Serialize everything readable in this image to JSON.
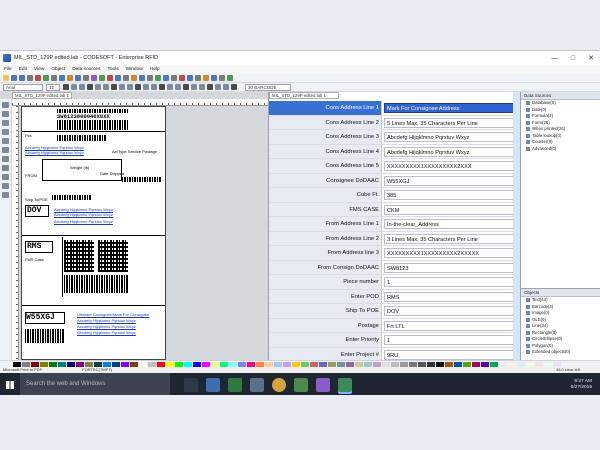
{
  "window": {
    "title": "MIL_STD_129P edited.lab - CODESOFT - Enterprise RFID",
    "controls": [
      "—",
      "□",
      "✕"
    ]
  },
  "menu": [
    "File",
    "Edit",
    "View",
    "Object",
    "Data sources",
    "Tools",
    "Window",
    "Help"
  ],
  "toolbar": {
    "font_combo": "Arial",
    "font_size": "12",
    "object_combo": "30 BARCODE"
  },
  "doc_tab": "MIL_STD_129P edited.lab 1",
  "prop_tab": "MIL_STD_129P edited.lab 1",
  "properties": [
    {
      "name": "Cons Address Line 1",
      "value": "Mark For Consignee Address",
      "selected": true
    },
    {
      "name": "Cons Address Line 2",
      "value": "5 Lines Max, 35 Characters Per Line"
    },
    {
      "name": "Cons Address Line 3",
      "value": "Abcdefg Hijqklmno Pqrstuv Wxyz"
    },
    {
      "name": "Cons Address Line 4",
      "value": "Abcdefg Hijqklmno Pqrstuv Wxyz"
    },
    {
      "name": "Cons Address Line 5",
      "value": "XXXXXXXXX1XXXXXXXXX2XXX"
    },
    {
      "name": "Consignee DoDAAC",
      "value": "W55XGJ"
    },
    {
      "name": "Cube Ft.",
      "value": "385"
    },
    {
      "name": "FMS CASE",
      "value": "CKM"
    },
    {
      "name": "From Address Line 1",
      "value": "In-the-clear_Address"
    },
    {
      "name": "From Address Line 2",
      "value": "3 Lines Max, 35 Characters Per Line"
    },
    {
      "name": "From Address line 3",
      "value": "XXXXXXXXX1XXXXXXXXX2XXXXX"
    },
    {
      "name": "From Consign DoDAAC",
      "value": "SW8123"
    },
    {
      "name": "Piece number",
      "value": "1"
    },
    {
      "name": "Enter POD",
      "value": "RMS"
    },
    {
      "name": "Ship To POE",
      "value": "DOV"
    },
    {
      "name": "Postage",
      "value": "Frt LTL"
    },
    {
      "name": "Enter Priority",
      "value": "1"
    },
    {
      "name": "Enter Project #",
      "value": "9RU"
    }
  ],
  "data_sources": {
    "title": "Data Sources",
    "items": [
      "Database(0)",
      "Date(0)",
      "Formula(2)",
      "Form(26)",
      "When printed(26)",
      "Table lookup(0)",
      "Counter(0)",
      "Advanced(0)"
    ]
  },
  "objects": {
    "title": "Objects",
    "items": [
      "Text(44)",
      "Barcode(4)",
      "Image(0)",
      "OLE(0)",
      "Line(34)",
      "Rectangle(0)",
      "Circle/Ellipse(0)",
      "Polygon(0)",
      "Extended objects(0)"
    ]
  },
  "label": {
    "top_code": "SW8123800040X0XX",
    "pod": "RMS",
    "poe": "DOV",
    "consignee": "W55XGJ",
    "ultimate": "Ultimate Consignee/Mark For Consignee",
    "from_label": "FROM:",
    "pcs_label": "Pcs",
    "fms_label": "FMS Case",
    "type_service": "Air/Type Service Postage",
    "shipto_label": "Ship To/POE",
    "weight_label": "Weight (lb)",
    "date_shipped": "Date Shipped",
    "line_text": "Abcdefg Hijqklmno Pqrstuv Wxyz"
  },
  "status": {
    "left": "Microsoft Print to PDF",
    "mid": "FORTEC(TMPT)",
    "right": "36.0 clear left"
  },
  "taskbar": {
    "search": "Search the web and Windows",
    "time": "8:27 AM",
    "date": "6/27/2015"
  },
  "palette_colors": [
    "#000000",
    "#808080",
    "#800000",
    "#808000",
    "#008000",
    "#008080",
    "#000080",
    "#800080",
    "#808040",
    "#004040",
    "#0080ff",
    "#004080",
    "#8000ff",
    "#804000",
    "#ffffff",
    "#c0c0c0",
    "#ff0000",
    "#ffff00",
    "#00ff00",
    "#00ffff",
    "#0000ff",
    "#ff00ff",
    "#ffff80",
    "#00ff80",
    "#80ffff",
    "#8080ff",
    "#ff0080",
    "#ff8040",
    "#ffcc99",
    "#99ccff",
    "#cc99ff",
    "#ffcc00",
    "#66cc66",
    "#cc6666",
    "#6666cc",
    "#999966",
    "#669999",
    "#996699",
    "#cccc99",
    "#99cccc",
    "#cc99cc",
    "#dddddd",
    "#bbbbbb",
    "#999999",
    "#777777",
    "#555555",
    "#333333",
    "#111111",
    "#aa5500",
    "#0055aa",
    "#55aa00",
    "#aa0055",
    "#5500aa",
    "#00aa55",
    "#eeeeee",
    "#ffeedd",
    "#ddeeff",
    "#eeffdd",
    "#ffddee",
    "#ddffee",
    "#eeddff"
  ]
}
